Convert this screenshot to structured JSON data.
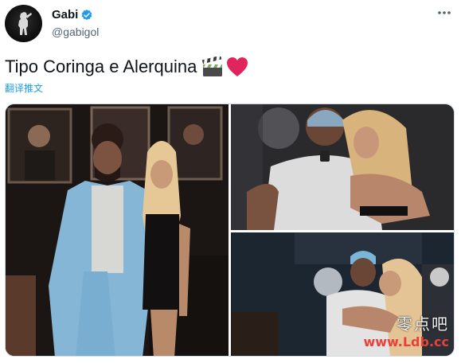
{
  "author": {
    "display_name": "Gabi",
    "handle": "@gabigol",
    "verified_icon": "verified-badge-icon",
    "avatar_icon": "avatar-silhouette"
  },
  "menu": {
    "more_icon": "more-horizontal-icon"
  },
  "tweet": {
    "text": "Tipo Coringa e Alerquina",
    "emojis": [
      "clapper-board-emoji",
      "red-heart-emoji"
    ],
    "translate_label": "翻译推文"
  },
  "media": {
    "photo_count": 3
  },
  "watermark": {
    "cn": "零点吧",
    "url": "www.Ldb.cc"
  },
  "colors": {
    "link": "#1d9bf0",
    "secondary_text": "#536471",
    "primary_text": "#0f1419",
    "heart": "#e0245e"
  }
}
